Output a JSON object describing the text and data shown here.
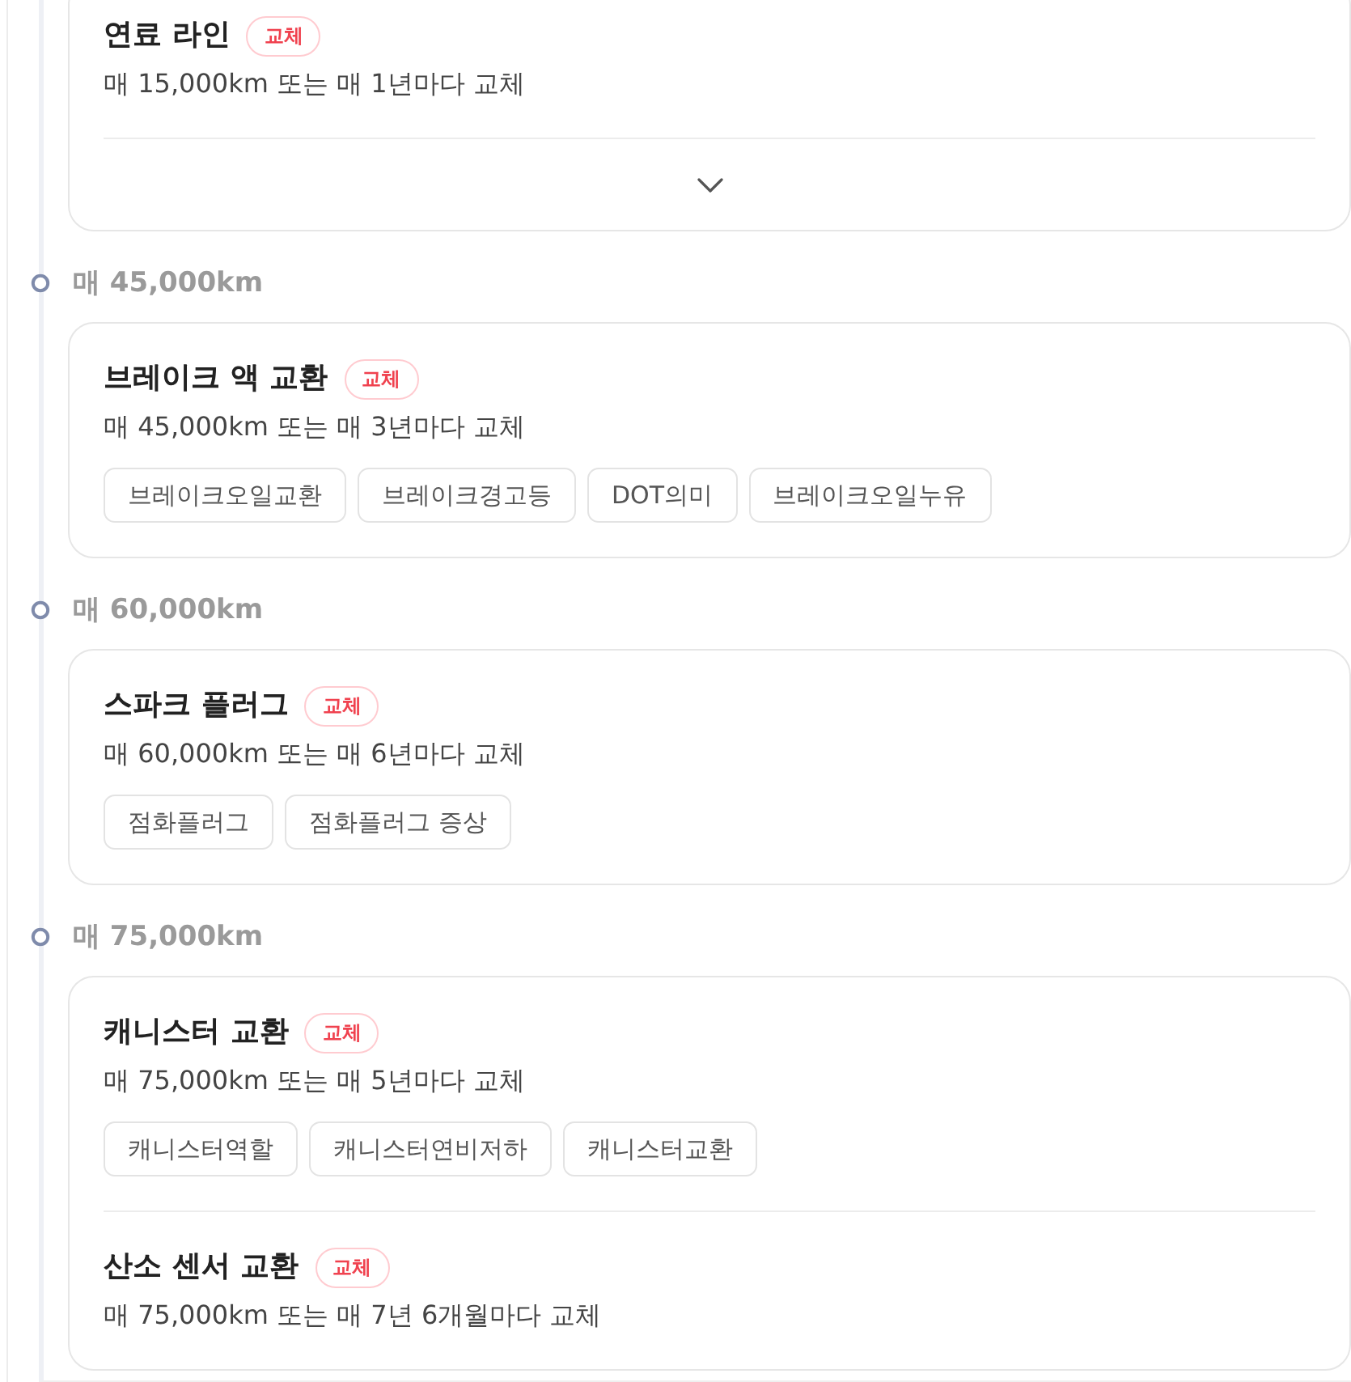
{
  "timeline": [
    {
      "items": [
        {
          "title": "연료 라인",
          "badge": "교체",
          "description": "매 15,000km 또는 매 1년마다 교체"
        }
      ],
      "expand_toggle": {
        "expanded": false
      }
    },
    {
      "heading": "매 45,000km",
      "items": [
        {
          "title": "브레이크 액 교환",
          "badge": "교체",
          "description": "매 45,000km 또는 매 3년마다 교체",
          "tags": [
            "브레이크오일교환",
            "브레이크경고등",
            "DOT의미",
            "브레이크오일누유"
          ]
        }
      ]
    },
    {
      "heading": "매 60,000km",
      "items": [
        {
          "title": "스파크 플러그",
          "badge": "교체",
          "description": "매 60,000km 또는 매 6년마다 교체",
          "tags": [
            "점화플러그",
            "점화플러그 증상"
          ]
        }
      ]
    },
    {
      "heading": "매 75,000km",
      "items": [
        {
          "title": "캐니스터 교환",
          "badge": "교체",
          "description": "매 75,000km 또는 매 5년마다 교체",
          "tags": [
            "캐니스터역할",
            "캐니스터연비저하",
            "캐니스터교환"
          ]
        },
        {
          "title": "산소 센서 교환",
          "badge": "교체",
          "description": "매 75,000km 또는 매 7년 6개월마다 교체"
        }
      ]
    }
  ]
}
